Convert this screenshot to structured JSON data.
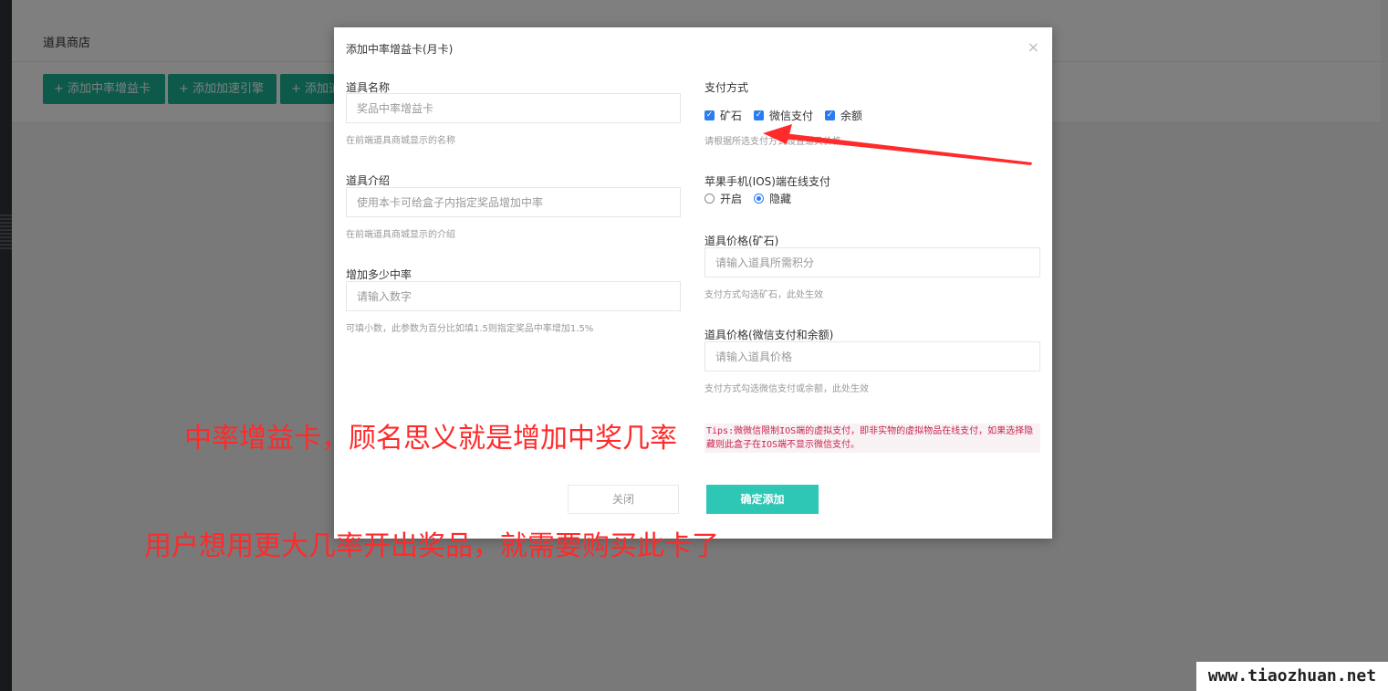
{
  "background": {
    "panel_title": "道具商店",
    "buttons": [
      "+ 添加中率增益卡",
      "+ 添加加速引擎",
      "+ 添加道"
    ]
  },
  "modal": {
    "title": "添加中率增益卡(月卡)",
    "close_symbol": "×",
    "fields": {
      "name": {
        "label": "道具名称",
        "placeholder": "奖品中率增益卡",
        "help": "在前端道具商城显示的名称"
      },
      "intro": {
        "label": "道具介绍",
        "placeholder": "使用本卡可给盒子内指定奖品增加中率",
        "help": "在前端道具商城显示的介绍"
      },
      "rate": {
        "label": "增加多少中率",
        "placeholder": "请输入数字",
        "help": "可填小数，此参数为百分比如填1.5则指定奖品中率增加1.5%"
      },
      "payment": {
        "label": "支付方式",
        "options": [
          "矿石",
          "微信支付",
          "余额"
        ],
        "help": "请根据所选支付方式设置道具价格"
      },
      "ios": {
        "label": "苹果手机(IOS)端在线支付",
        "options": [
          "开启",
          "隐藏"
        ],
        "selected": "隐藏"
      },
      "price_ore": {
        "label": "道具价格(矿石)",
        "placeholder": "请输入道具所需积分",
        "help": "支付方式勾选矿石，此处生效"
      },
      "price_wx": {
        "label": "道具价格(微信支付和余额)",
        "placeholder": "请输入道具价格",
        "help": "支付方式勾选微信支付或余额，此处生效"
      }
    },
    "tips": "Tips:微微信限制IOS端的虚拟支付，即非实物的虚拟物品在线支付，如果选择隐藏则此盒子在IOS端不显示微信支付。",
    "close_label": "关闭",
    "confirm_label": "确定添加"
  },
  "annotations": {
    "line1": "中率增益卡，顾名思义就是增加中奖几率",
    "line2": "用户想用更大几率开出奖品，就需要购买此卡了",
    "color": "#ff2a2a"
  },
  "watermark": "www.tiaozhuan.net"
}
